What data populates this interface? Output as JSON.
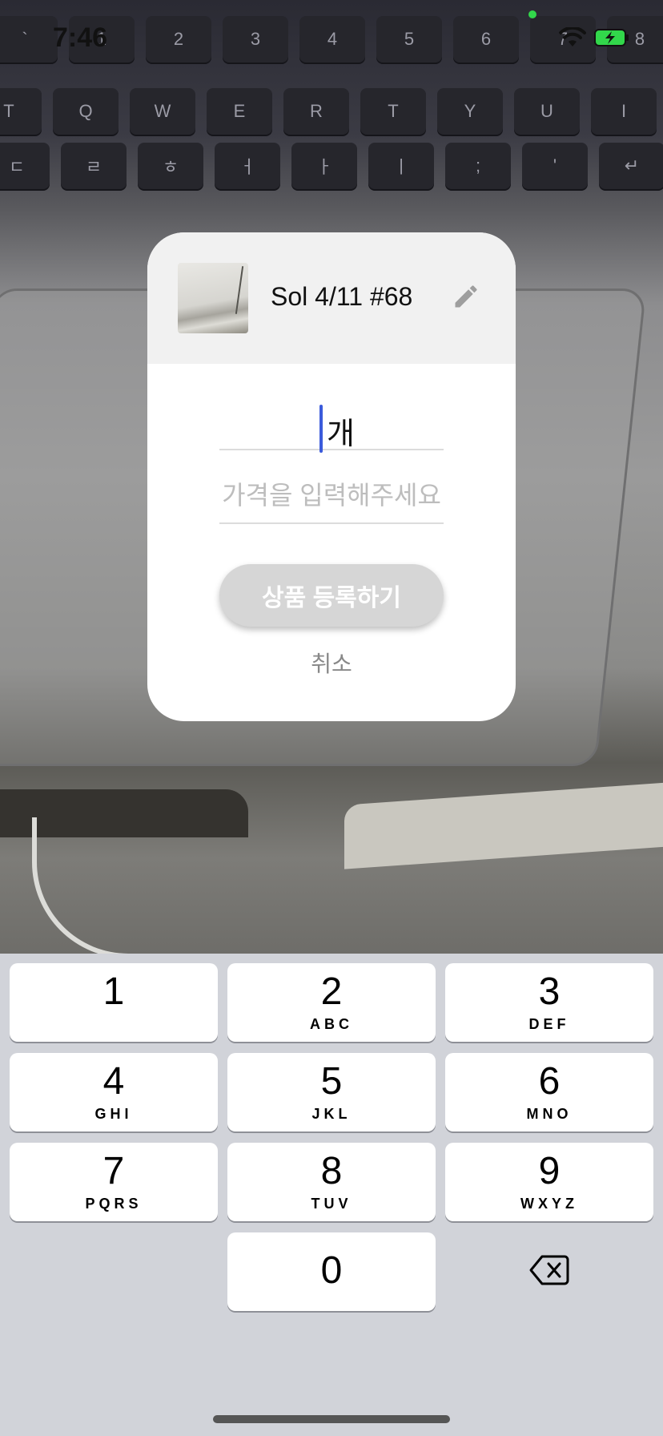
{
  "status_bar": {
    "time": "7:46"
  },
  "dialog": {
    "product_name": "Sol 4/11 #68",
    "quantity_unit": "개",
    "price_placeholder": "가격을 입력해주세요",
    "register_button_label": "상품 등록하기",
    "cancel_label": "취소"
  },
  "background_keyboard": {
    "row1": [
      "`",
      "1",
      "2",
      "3",
      "4",
      "5",
      "6",
      "7",
      "8"
    ],
    "row2": [
      "T",
      "Q",
      "W",
      "E",
      "R",
      "T",
      "Y",
      "U",
      "I"
    ],
    "row3": [
      "ㄷ",
      "ㄹ",
      "ㅎ",
      "ㅓ",
      "ㅏ",
      "ㅣ",
      ";",
      "'",
      "↵"
    ]
  },
  "keypad": {
    "keys": [
      {
        "digit": "1",
        "letters": ""
      },
      {
        "digit": "2",
        "letters": "ABC"
      },
      {
        "digit": "3",
        "letters": "DEF"
      },
      {
        "digit": "4",
        "letters": "GHI"
      },
      {
        "digit": "5",
        "letters": "JKL"
      },
      {
        "digit": "6",
        "letters": "MNO"
      },
      {
        "digit": "7",
        "letters": "PQRS"
      },
      {
        "digit": "8",
        "letters": "TUV"
      },
      {
        "digit": "9",
        "letters": "WXYZ"
      },
      {
        "digit": "0",
        "letters": ""
      }
    ]
  },
  "colors": {
    "cursor": "#3b5bdb",
    "button_disabled": "#d6d6d6",
    "placeholder": "#bdbdbd",
    "battery_charging": "#32d74b"
  },
  "icons": {
    "edit": "pencil-icon",
    "delete": "backspace-icon",
    "wifi": "wifi-icon",
    "battery": "battery-charging-icon"
  }
}
